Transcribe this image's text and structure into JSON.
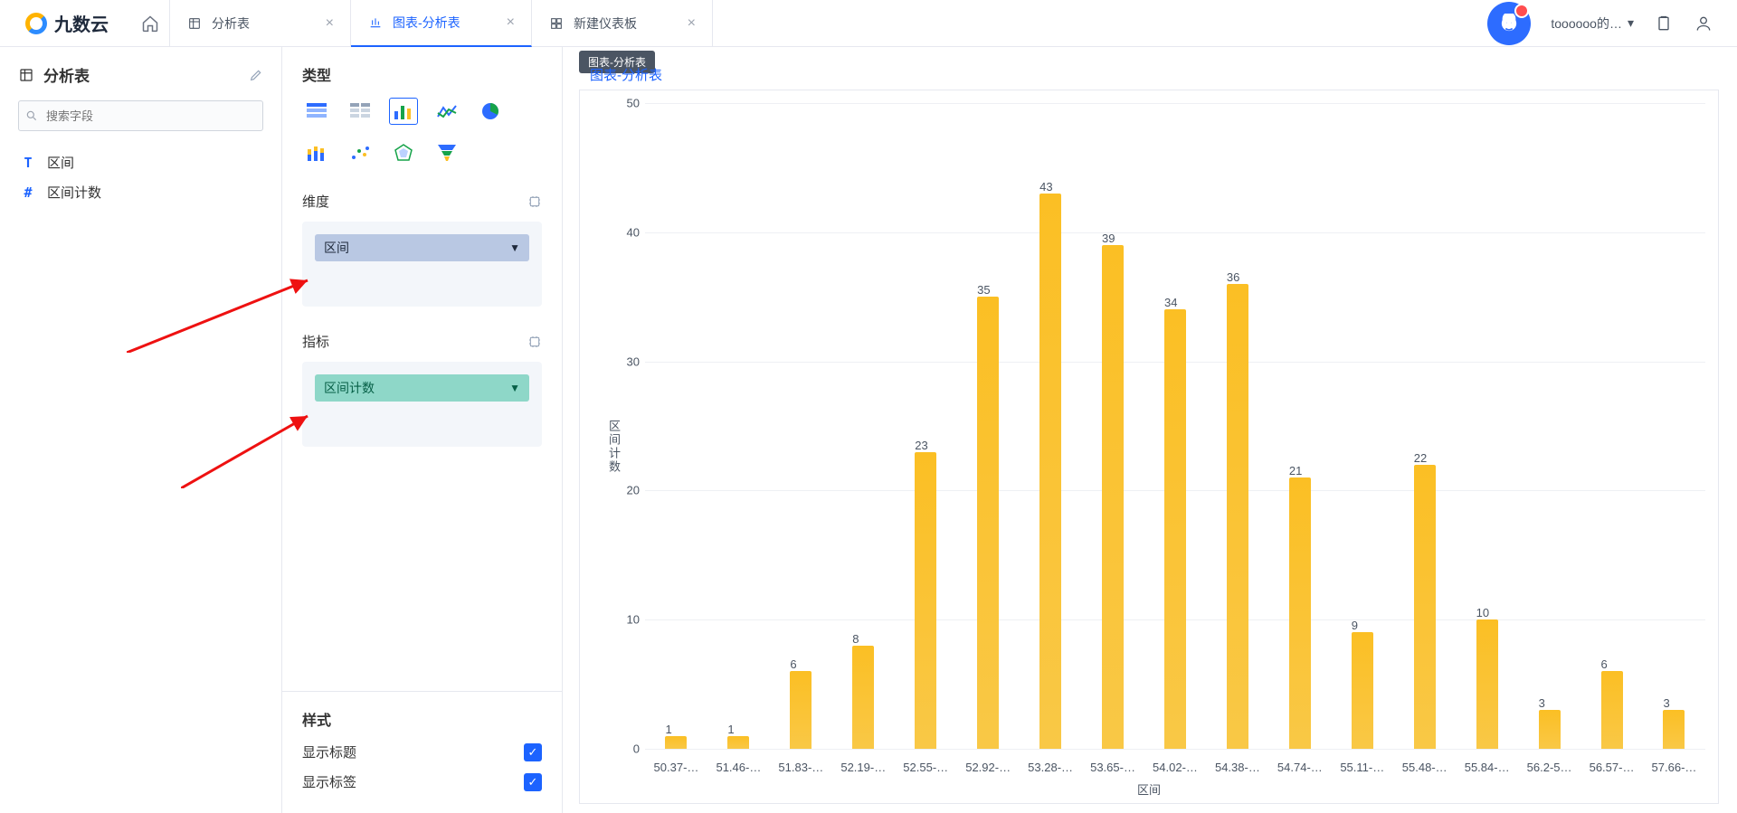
{
  "brand": "九数云",
  "tabs": [
    {
      "label": "分析表",
      "active": false
    },
    {
      "label": "图表-分析表",
      "active": true
    },
    {
      "label": "新建仪表板",
      "active": false
    }
  ],
  "tooltip": "图表-分析表",
  "user_label": "toooooo的…",
  "fields_panel": {
    "title": "分析表",
    "search_placeholder": "搜索字段",
    "fields": [
      {
        "icon": "T",
        "label": "区间"
      },
      {
        "icon": "#",
        "label": "区间计数"
      }
    ]
  },
  "config_panel": {
    "type_heading": "类型",
    "dimension_heading": "维度",
    "metric_heading": "指标",
    "dimension_pill": "区间",
    "metric_pill": "区间计数",
    "style_heading": "样式",
    "style_options": [
      {
        "label": "显示标题",
        "checked": true
      },
      {
        "label": "显示标签",
        "checked": true
      }
    ]
  },
  "chart_data": {
    "type": "bar",
    "title": "图表-分析表",
    "xlabel": "区间",
    "ylabel": "区间计数",
    "ylim": [
      0,
      50
    ],
    "yticks": [
      0,
      10,
      20,
      30,
      40,
      50
    ],
    "categories": [
      "50.37-…",
      "51.46-…",
      "51.83-…",
      "52.19-…",
      "52.55-…",
      "52.92-…",
      "53.28-…",
      "53.65-…",
      "54.02-…",
      "54.38-…",
      "54.74-…",
      "55.11-…",
      "55.48-…",
      "55.84-…",
      "56.2-5…",
      "56.57-…",
      "57.66-…"
    ],
    "values": [
      1,
      1,
      6,
      8,
      23,
      35,
      43,
      39,
      34,
      36,
      21,
      9,
      22,
      10,
      3,
      6,
      3
    ]
  }
}
